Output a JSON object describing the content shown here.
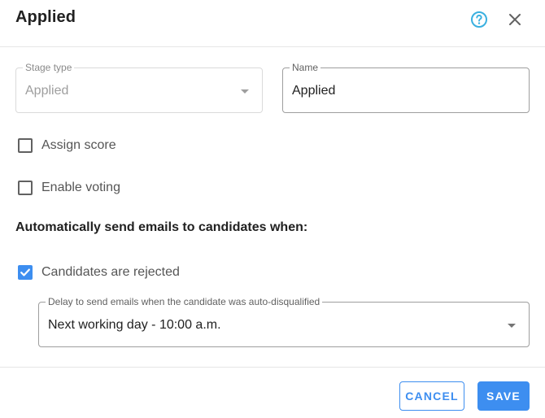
{
  "dialog": {
    "title": "Applied"
  },
  "header": {
    "help_icon": "help-circle-icon",
    "close_icon": "close-icon"
  },
  "stage_type": {
    "label": "Stage type",
    "value": "Applied",
    "disabled": true
  },
  "name_field": {
    "label": "Name",
    "value": "Applied"
  },
  "checkboxes": {
    "assign_score": {
      "label": "Assign score",
      "checked": false
    },
    "enable_voting": {
      "label": "Enable voting",
      "checked": false
    },
    "candidates_rejected": {
      "label": "Candidates are rejected",
      "checked": true
    }
  },
  "emails": {
    "section_title": "Automatically send emails to candidates when:",
    "delay": {
      "label": "Delay to send emails when the candidate was auto-disqualified",
      "value": "Next working day - 10:00 a.m."
    }
  },
  "footer": {
    "cancel_label": "CANCEL",
    "save_label": "SAVE"
  },
  "colors": {
    "accent": "#3d8ef0",
    "help_icon": "#3ab0e0"
  }
}
